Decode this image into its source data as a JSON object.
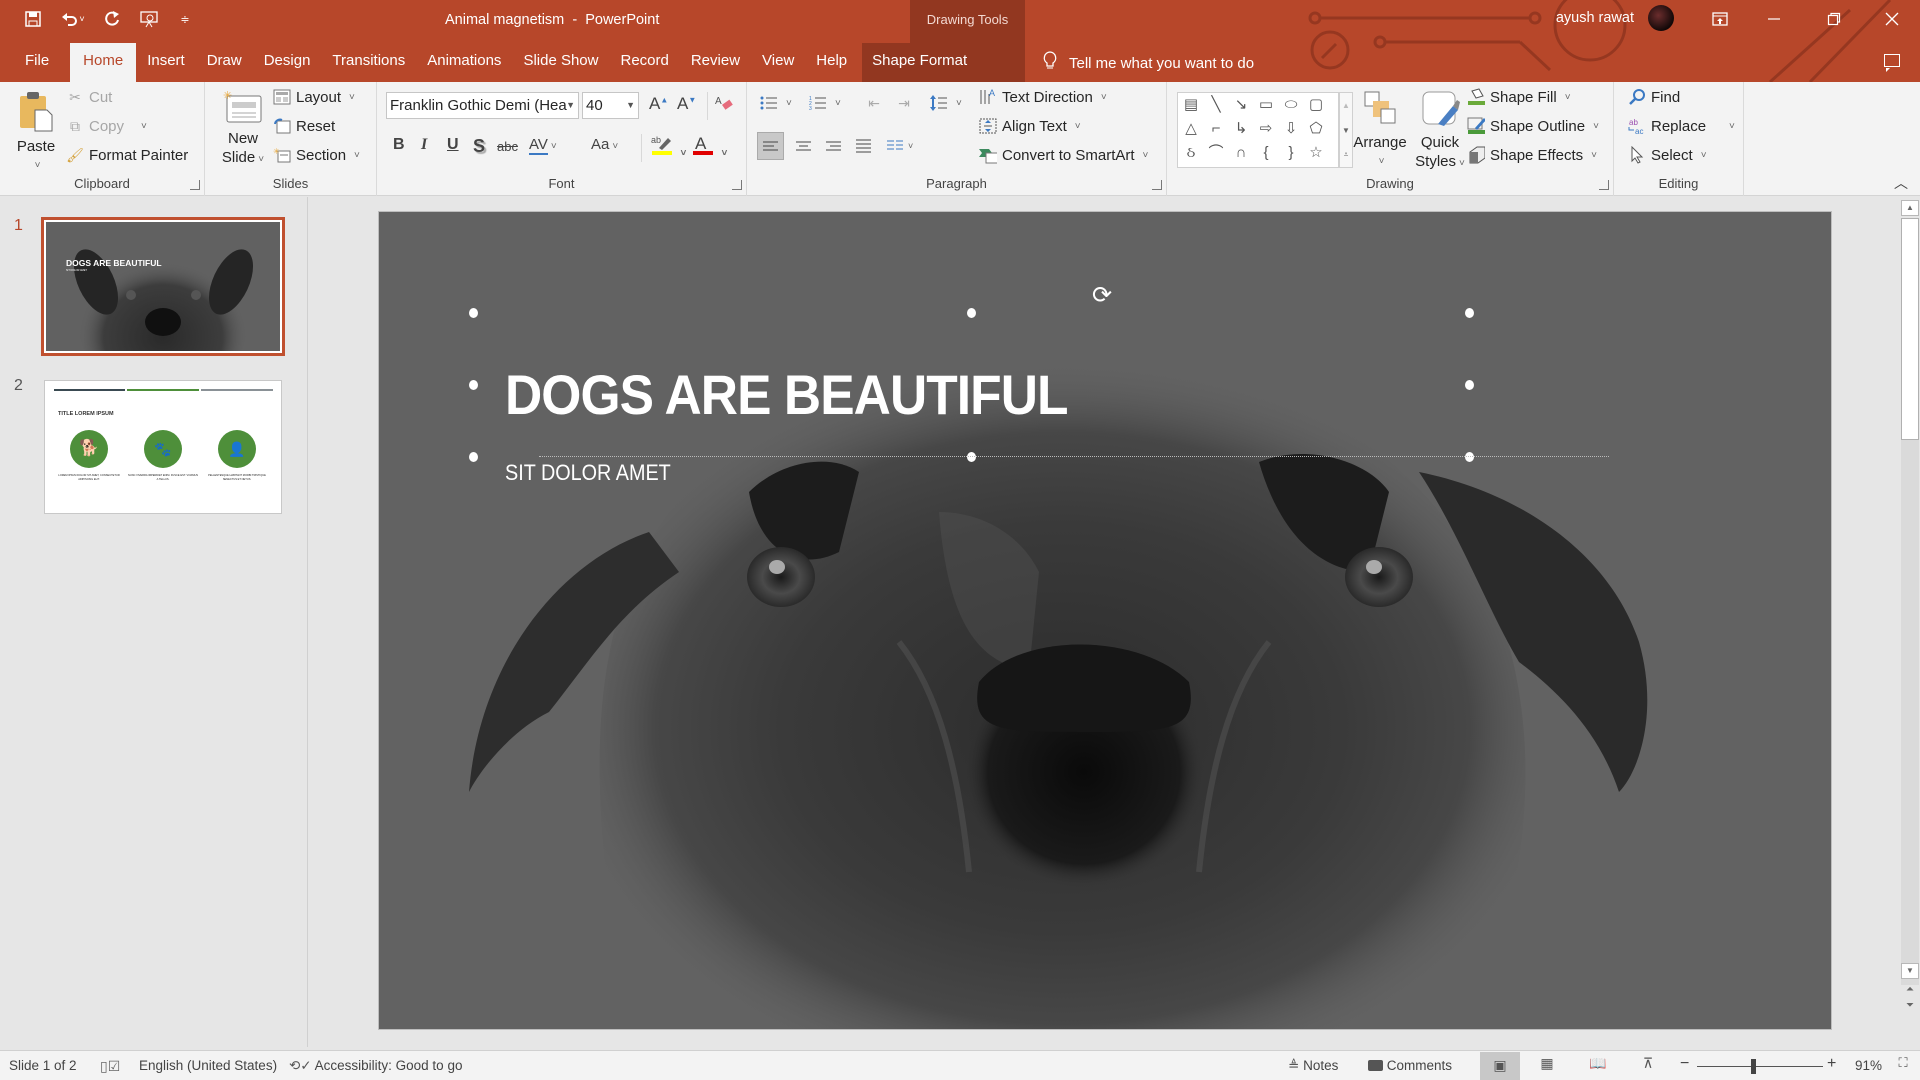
{
  "app": {
    "document_title": "Animal magnetism",
    "app_name": "PowerPoint",
    "title_separator": " - ",
    "context_tab_group": "Drawing Tools",
    "user_name": "ayush rawat",
    "accent_color": "#b7472a"
  },
  "quick_access": {
    "save_icon": "save-icon",
    "undo_icon": "undo-icon",
    "redo_icon": "redo-icon",
    "present_icon": "start-from-beginning-icon",
    "customize_icon": "customize-qat-icon"
  },
  "tabs": [
    {
      "label": "File",
      "active": false
    },
    {
      "label": "Home",
      "active": true
    },
    {
      "label": "Insert",
      "active": false
    },
    {
      "label": "Draw",
      "active": false
    },
    {
      "label": "Design",
      "active": false
    },
    {
      "label": "Transitions",
      "active": false
    },
    {
      "label": "Animations",
      "active": false
    },
    {
      "label": "Slide Show",
      "active": false
    },
    {
      "label": "Record",
      "active": false
    },
    {
      "label": "Review",
      "active": false
    },
    {
      "label": "View",
      "active": false
    },
    {
      "label": "Help",
      "active": false
    },
    {
      "label": "Shape Format",
      "active": false
    }
  ],
  "tell_me": "Tell me what you want to do",
  "ribbon": {
    "clipboard": {
      "label": "Clipboard",
      "paste": "Paste",
      "cut": "Cut",
      "copy": "Copy",
      "format_painter": "Format Painter"
    },
    "slides": {
      "label": "Slides",
      "new_slide_line1": "New",
      "new_slide_line2": "Slide",
      "layout": "Layout",
      "reset": "Reset",
      "section": "Section"
    },
    "font": {
      "label": "Font",
      "font_name": "Franklin Gothic Demi (Hea",
      "font_size": "40",
      "bold": "B",
      "italic": "I",
      "underline": "U",
      "shadow": "S",
      "strikethrough": "abc",
      "char_spacing": "AV",
      "change_case": "Aa",
      "highlight_color": "#ffff00",
      "font_color": "#e00000"
    },
    "paragraph": {
      "label": "Paragraph",
      "text_direction": "Text Direction",
      "align_text": "Align Text",
      "convert_smartart": "Convert to SmartArt"
    },
    "drawing": {
      "label": "Drawing",
      "arrange": "Arrange",
      "quick_styles_line1": "Quick",
      "quick_styles_line2": "Styles",
      "shape_fill": "Shape Fill",
      "shape_outline": "Shape Outline",
      "shape_effects": "Shape Effects",
      "shapes": [
        "text-box",
        "line",
        "arrow",
        "rectangle",
        "oval",
        "rounded-rectangle",
        "triangle",
        "elbow-connector",
        "elbow-arrow",
        "right-arrow",
        "down-arrow",
        "snip-shape",
        "freeform",
        "arc",
        "curve",
        "left-brace",
        "right-brace",
        "star"
      ]
    },
    "editing": {
      "label": "Editing",
      "find": "Find",
      "replace": "Replace",
      "select": "Select"
    }
  },
  "thumbnails": [
    {
      "number": "1",
      "title": "DOGS ARE BEAUTIFUL",
      "subtitle": "SIT DOLOR AMET",
      "selected": true
    },
    {
      "number": "2",
      "title": "TITLE LOREM IPSUM",
      "selected": false,
      "captions": [
        "LOREM IPSUM DOLOR SIT AMET, CONSECTETUR ADIPISCING ELIT.",
        "NUNC VIVERRA IMPERDIET ENIM. FUSCE EST. VIVAMUS A TELLUS.",
        "PELLENTESQUE HABITANT MORBI TRISTIQUE SENECTUS ET NETUS."
      ],
      "icons": [
        "dog-icon",
        "paw-prints-icon",
        "veterinarian-icon"
      ],
      "bar_colors": [
        "#3a4a52",
        "#4e8f3a",
        "#8a9196"
      ]
    }
  ],
  "slide": {
    "title": "DOGS ARE BEAUTIFUL",
    "subtitle": "SIT DOLOR AMET",
    "background_image": "dog-face-photo"
  },
  "status": {
    "slide_indicator": "Slide 1 of 2",
    "language": "English (United States)",
    "accessibility": "Accessibility: Good to go",
    "notes": "Notes",
    "comments": "Comments",
    "zoom_percent": "91%",
    "zoom_value": 0.91
  }
}
